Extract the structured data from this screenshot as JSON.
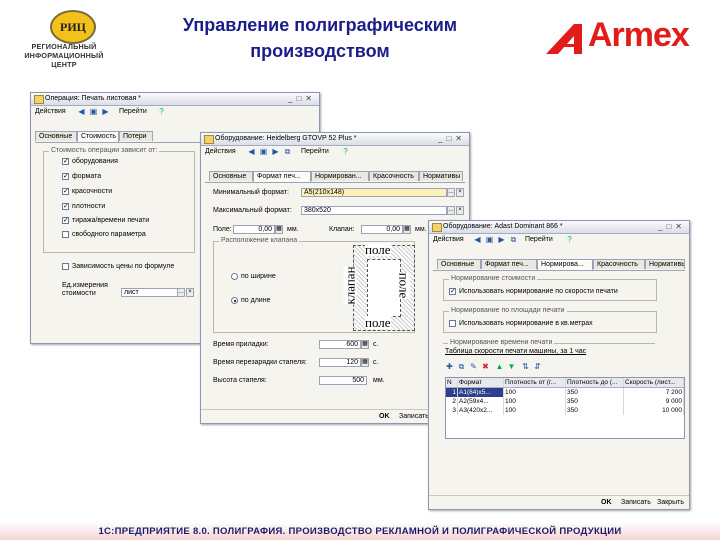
{
  "header": {
    "logo_badge": "РИЦ",
    "logo_line1": "РЕГИОНАЛЬНЫЙ",
    "logo_line2": "ИНФОРМАЦИОННЫЙ",
    "logo_line3": "ЦЕНТР",
    "title_line1": "Управление полиграфическим",
    "title_line2": "производством",
    "brand": "Armex",
    "title_color": "#1c1c8a",
    "brand_color": "#e21b1b"
  },
  "win1": {
    "title": "Операция: Печать листовая *",
    "actions": "Действия",
    "goto": "Перейти",
    "tabs": [
      "Основные",
      "Стоимость",
      "Потери"
    ],
    "frame_legend": "Стоимость операции зависит от:",
    "checks": [
      {
        "label": "оборудования",
        "checked": true
      },
      {
        "label": "формата",
        "checked": true
      },
      {
        "label": "красочности",
        "checked": true
      },
      {
        "label": "плотности",
        "checked": true
      },
      {
        "label": "тиража/времени печати",
        "checked": true
      },
      {
        "label": "свободного параметра",
        "checked": false
      }
    ],
    "format_dependence": "Зависимость цены по формуле",
    "unit_label_1": "Ед.измерения",
    "unit_label_2": "стоимости",
    "unit_value": "лист"
  },
  "win2": {
    "title": "Оборудование: Heidelberg GTOVP 52 Plus *",
    "actions": "Действия",
    "goto": "Перейти",
    "tabs": [
      "Основные",
      "Формат печ...",
      "Нормирован...",
      "Красочность",
      "Нормативы"
    ],
    "min_format_label": "Минимальный формат:",
    "min_format_value": "А5(210х148)",
    "max_format_label": "Максимальный формат:",
    "max_format_value": "380х520",
    "field_label": "Поле:",
    "field_value": "0,00",
    "valve_label": "Клапан:",
    "valve_value": "0,00",
    "unit_mm": "мм.",
    "valve_group": "Расположение клапана",
    "radio_width": "по ширине",
    "radio_length": "по длине",
    "diagram_pole": "поле",
    "diagram_klapan": "клапан",
    "time_prep_label": "Время приладки:",
    "time_prep_value": "600",
    "time_reload_label": "Время перезарядки стапеля:",
    "time_reload_value": "120",
    "unit_sec": "с.",
    "stack_label": "Высота стапеля:",
    "stack_value": "500",
    "ok": "OK",
    "save": "Записать"
  },
  "win3": {
    "title": "Оборудование: Adast Dominant 866 *",
    "actions": "Действия",
    "goto": "Перейти",
    "tabs": [
      "Основные",
      "Формат печ...",
      "Нормирова...",
      "Красочность",
      "Нормативы"
    ],
    "cost_group": "Нормирование стоимости",
    "cost_check": "Использовать нормирование по скорости печати",
    "area_group": "Нормирование по площади печати",
    "area_check": "Использовать нормирование в кв.метрах",
    "time_group": "Нормирование времени печати",
    "table_caption": "Таблица скорости печати машины, за 1 час",
    "columns": [
      "N",
      "Формат",
      "Плотность от (г...",
      "Плотность до (...",
      "Скорость (лист..."
    ],
    "rows": [
      [
        "1",
        "А1(84)х5...",
        "100",
        "350",
        "7 200"
      ],
      [
        "2",
        "А2(59х4...",
        "100",
        "350",
        "9 000"
      ],
      [
        "3",
        "А3(420х2...",
        "100",
        "350",
        "10 000"
      ]
    ],
    "ok": "OK",
    "save": "Записать",
    "close": "Закрыть"
  },
  "footer": {
    "text": "1С:ПРЕДПРИЯТИЕ 8.0. ПОЛИГРАФИЯ. ПРОИЗВОДСТВО РЕКЛАМНОЙ И ПОЛИГРАФИЧЕСКОЙ ПРОДУКЦИИ"
  }
}
